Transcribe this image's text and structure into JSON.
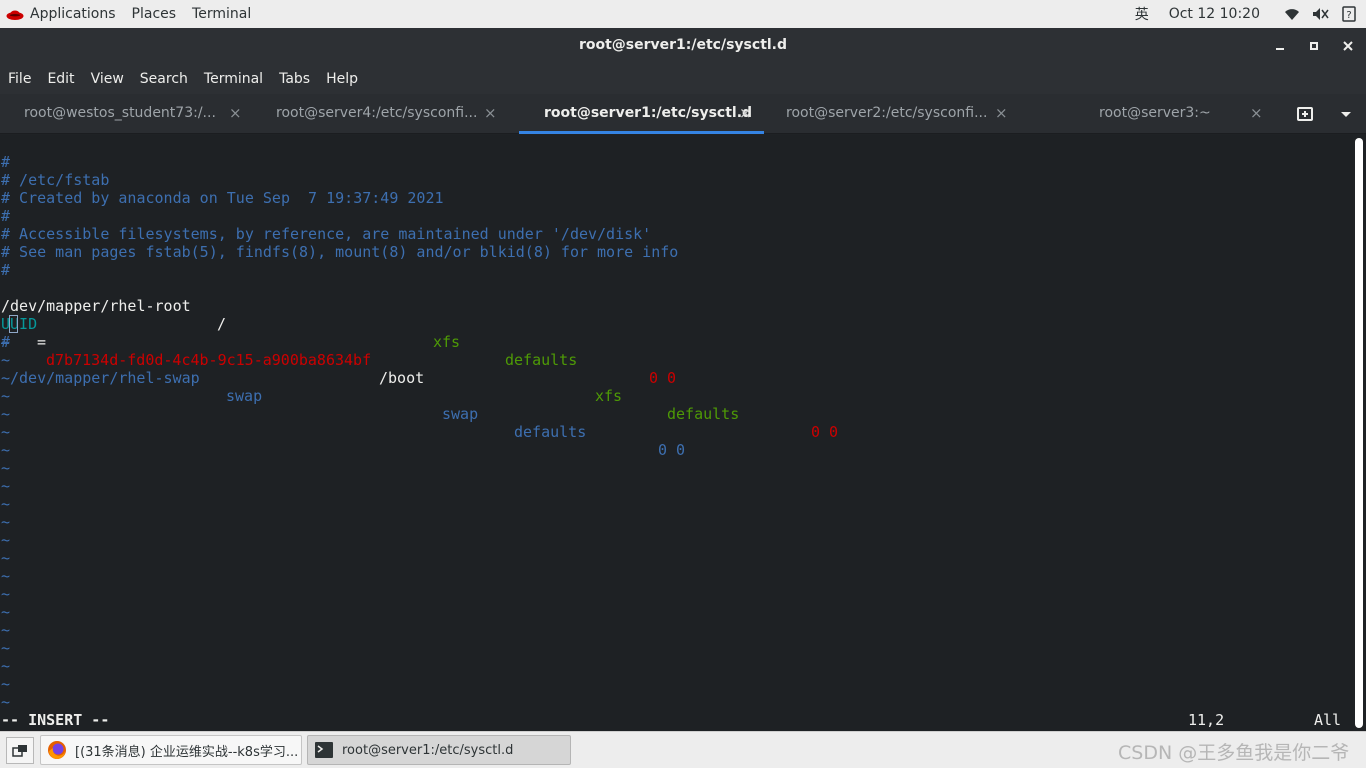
{
  "topbar": {
    "applications": "Applications",
    "places": "Places",
    "terminal": "Terminal",
    "input_method": "英",
    "datetime": "Oct 12  10:20",
    "icons": [
      "wifi-icon",
      "volume-icon",
      "accessibility-icon"
    ]
  },
  "window": {
    "title": "root@server1:/etc/sysctl.d",
    "minimize": "–",
    "maximize": "□",
    "close": "✕"
  },
  "menubar": [
    "File",
    "Edit",
    "View",
    "Search",
    "Terminal",
    "Tabs",
    "Help"
  ],
  "tabs": [
    {
      "label": "root@westos_student73:/...",
      "close": "×",
      "active": false
    },
    {
      "label": "root@server4:/etc/sysconfi...",
      "close": "×",
      "active": false
    },
    {
      "label": "root@server1:/etc/sysctl.d",
      "close": "×",
      "active": true
    },
    {
      "label": "root@server2:/etc/sysconfi...",
      "close": "×",
      "active": false
    },
    {
      "label": "root@server3:~",
      "close": "×",
      "active": false
    }
  ],
  "terminal": {
    "comments": [
      "#",
      "# /etc/fstab",
      "# Created by anaconda on Tue Sep  7 19:37:49 2021",
      "#",
      "# Accessible filesystems, by reference, are maintained under '/dev/disk'",
      "# See man pages fstab(5), findfs(8), mount(8) and/or blkid(8) for more info",
      "#"
    ],
    "root_entry": {
      "device": "/dev/mapper/rhel-root",
      "mount": "/",
      "fstype": "xfs",
      "options": "defaults",
      "dumppass": "0 0"
    },
    "boot_entry": {
      "uuid_key": "UUID",
      "eq": "=",
      "uuid": "d7b7134d-fd0d-4c4b-9c15-a900ba8634bf",
      "mount": "/boot",
      "fstype": "xfs",
      "options": "defaults",
      "dumppass": "0 0"
    },
    "swap_entry": {
      "hash": "#",
      "device": "/dev/mapper/rhel-swap",
      "mount": "swap",
      "fstype": "swap",
      "options": "defaults",
      "dumppass": "0 0"
    },
    "tilde": "~",
    "tilde_count": 21,
    "mode": "-- INSERT --",
    "position": "11,2",
    "scroll": "All"
  },
  "taskbar": {
    "tasks": [
      {
        "label": "[(31条消息) 企业运维实战--k8s学习...",
        "icon": "firefox-icon",
        "active": false
      },
      {
        "label": "root@server1:/etc/sysctl.d",
        "icon": "terminal-icon",
        "active": true
      }
    ],
    "watermark": "CSDN @王多鱼我是你二爷"
  },
  "colors": {
    "comment": "#3d6fb0",
    "green": "#4e9a06",
    "red": "#cc0000",
    "cyan": "#06989a",
    "tab_accent": "#3584e4"
  }
}
